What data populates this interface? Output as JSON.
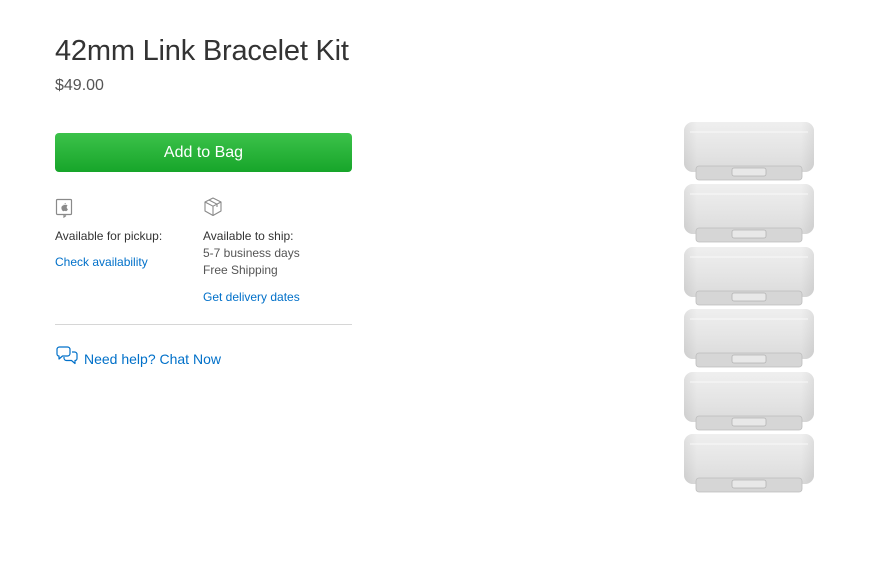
{
  "product": {
    "title": "42mm Link Bracelet Kit",
    "price": "$49.00"
  },
  "actions": {
    "add_to_bag_label": "Add to Bag"
  },
  "pickup": {
    "icon": "apple-store-icon",
    "label": "Available for pickup:",
    "link": "Check availability"
  },
  "shipping": {
    "icon": "box-icon",
    "label": "Available to ship:",
    "time": "5-7 business days",
    "cost": "Free Shipping",
    "link": "Get delivery dates"
  },
  "help": {
    "icon": "chat-bubbles-icon",
    "label": "Need help? Chat Now"
  },
  "colors": {
    "button_green": "#17a52a",
    "link_blue": "#0070c9"
  }
}
